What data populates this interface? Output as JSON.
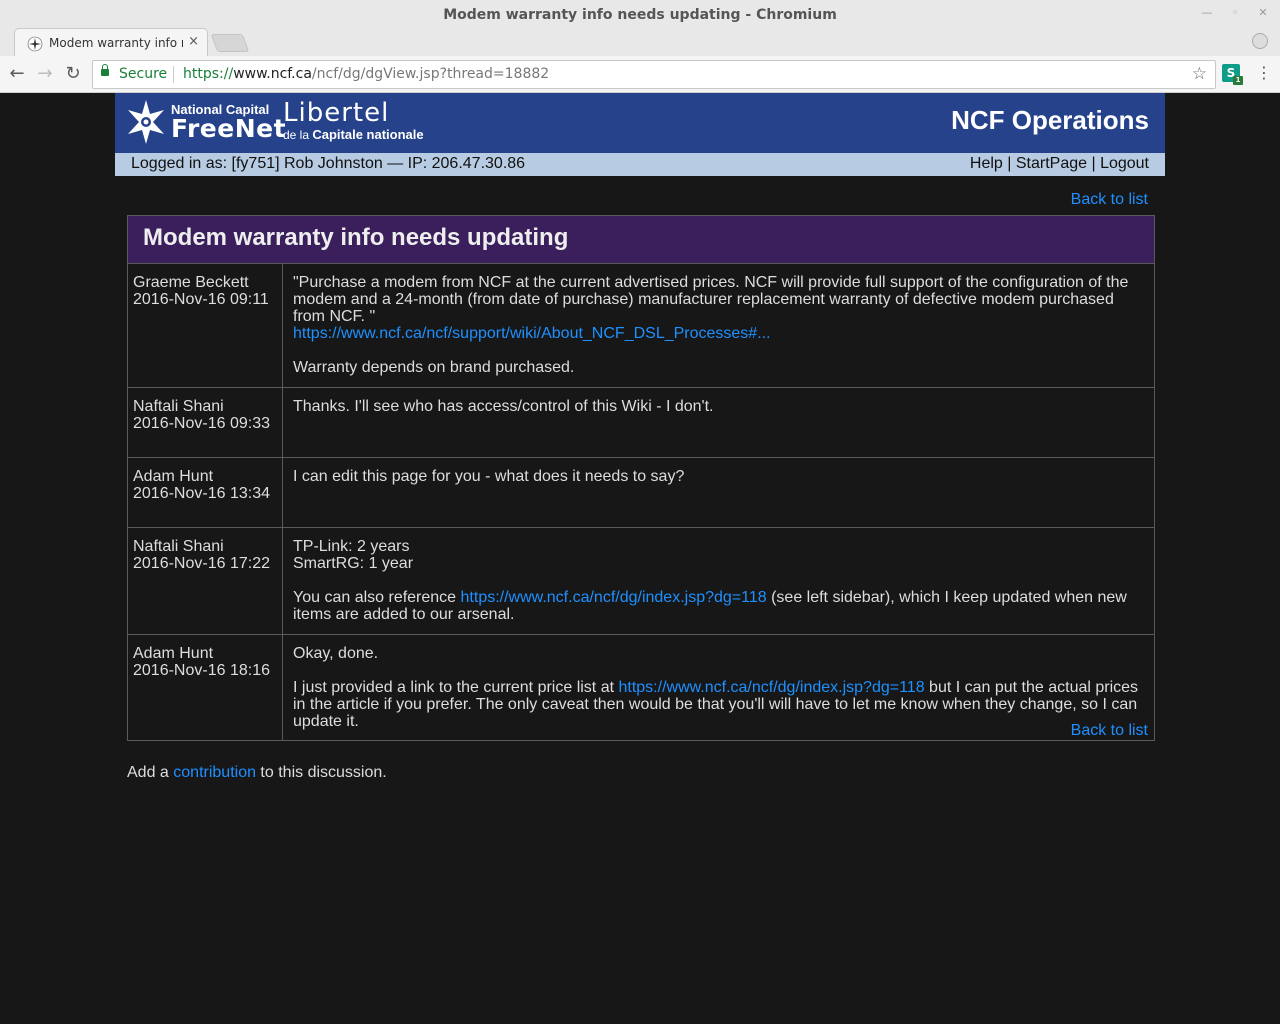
{
  "window": {
    "title": "Modem warranty info needs updating - Chromium"
  },
  "tab": {
    "title": "Modem warranty info n",
    "close": "×"
  },
  "toolbar": {
    "back": "←",
    "forward": "→",
    "reload": "↻",
    "secure_label": "Secure",
    "url_scheme": "https://",
    "url_host": "www.ncf.ca",
    "url_path": "/ncf/dg/dgView.jsp?thread=18882",
    "star": "☆",
    "ext_letter": "S",
    "ext_count": "1",
    "menu": "⋮"
  },
  "banner": {
    "logo_line1": "National Capital",
    "logo_line2": "FreeNet",
    "logo_line3": "Libertel",
    "logo_line4a": "de la",
    "logo_line4b": "Capitale nationale",
    "title": "NCF Operations"
  },
  "userbar": {
    "logged_in": "Logged in as: [fy751] Rob Johnston — IP: 206.47.30.86",
    "help": "Help",
    "sep": " | ",
    "startpage": "StartPage",
    "logout": "Logout"
  },
  "nav": {
    "back_to_list": "Back to list"
  },
  "thread": {
    "title": "Modem warranty info needs updating",
    "posts": [
      {
        "author": "Graeme Beckett",
        "date": "2016-Nov-16 09:11",
        "p1": "\"Purchase a modem from NCF at the current advertised prices. NCF will provide full support of the configuration of the modem and a 24-month (from date of purchase) manufacturer replacement warranty of defective modem purchased from NCF. \"",
        "link": "https://www.ncf.ca/ncf/support/wiki/About_NCF_DSL_Processes#...",
        "p2": "Warranty depends on brand purchased."
      },
      {
        "author": "Naftali Shani",
        "date": "2016-Nov-16 09:33",
        "p1": "Thanks. I'll see who has access/control of this Wiki - I don't."
      },
      {
        "author": "Adam Hunt",
        "date": "2016-Nov-16 13:34",
        "p1": "I can edit this page for you - what does it needs to say?"
      },
      {
        "author": "Naftali Shani",
        "date": "2016-Nov-16 17:22",
        "line1": "TP-Link: 2 years",
        "line2": "SmartRG: 1 year",
        "p2_before": "You can also reference ",
        "link": "https://www.ncf.ca/ncf/dg/index.jsp?dg=118",
        "p2_after": " (see left sidebar), which I keep updated when new items are added to our arsenal."
      },
      {
        "author": "Adam Hunt",
        "date": "2016-Nov-16 18:16",
        "p1": "Okay, done.",
        "p2_before": "I just provided a link to the current price list at ",
        "link": "https://www.ncf.ca/ncf/dg/index.jsp?dg=118",
        "p2_after": " but I can put the actual prices in the article if you prefer. The only caveat then would be that you'll will have to let me know when they change, so I can update it."
      }
    ]
  },
  "footer": {
    "before": "Add a ",
    "link": "contribution",
    "after": " to this discussion."
  },
  "colors": {
    "banner": "#26428a",
    "userbar": "#b7cbe2",
    "thread_header": "#3a1f5c",
    "link": "#1e90ff",
    "page_bg": "#171717"
  }
}
